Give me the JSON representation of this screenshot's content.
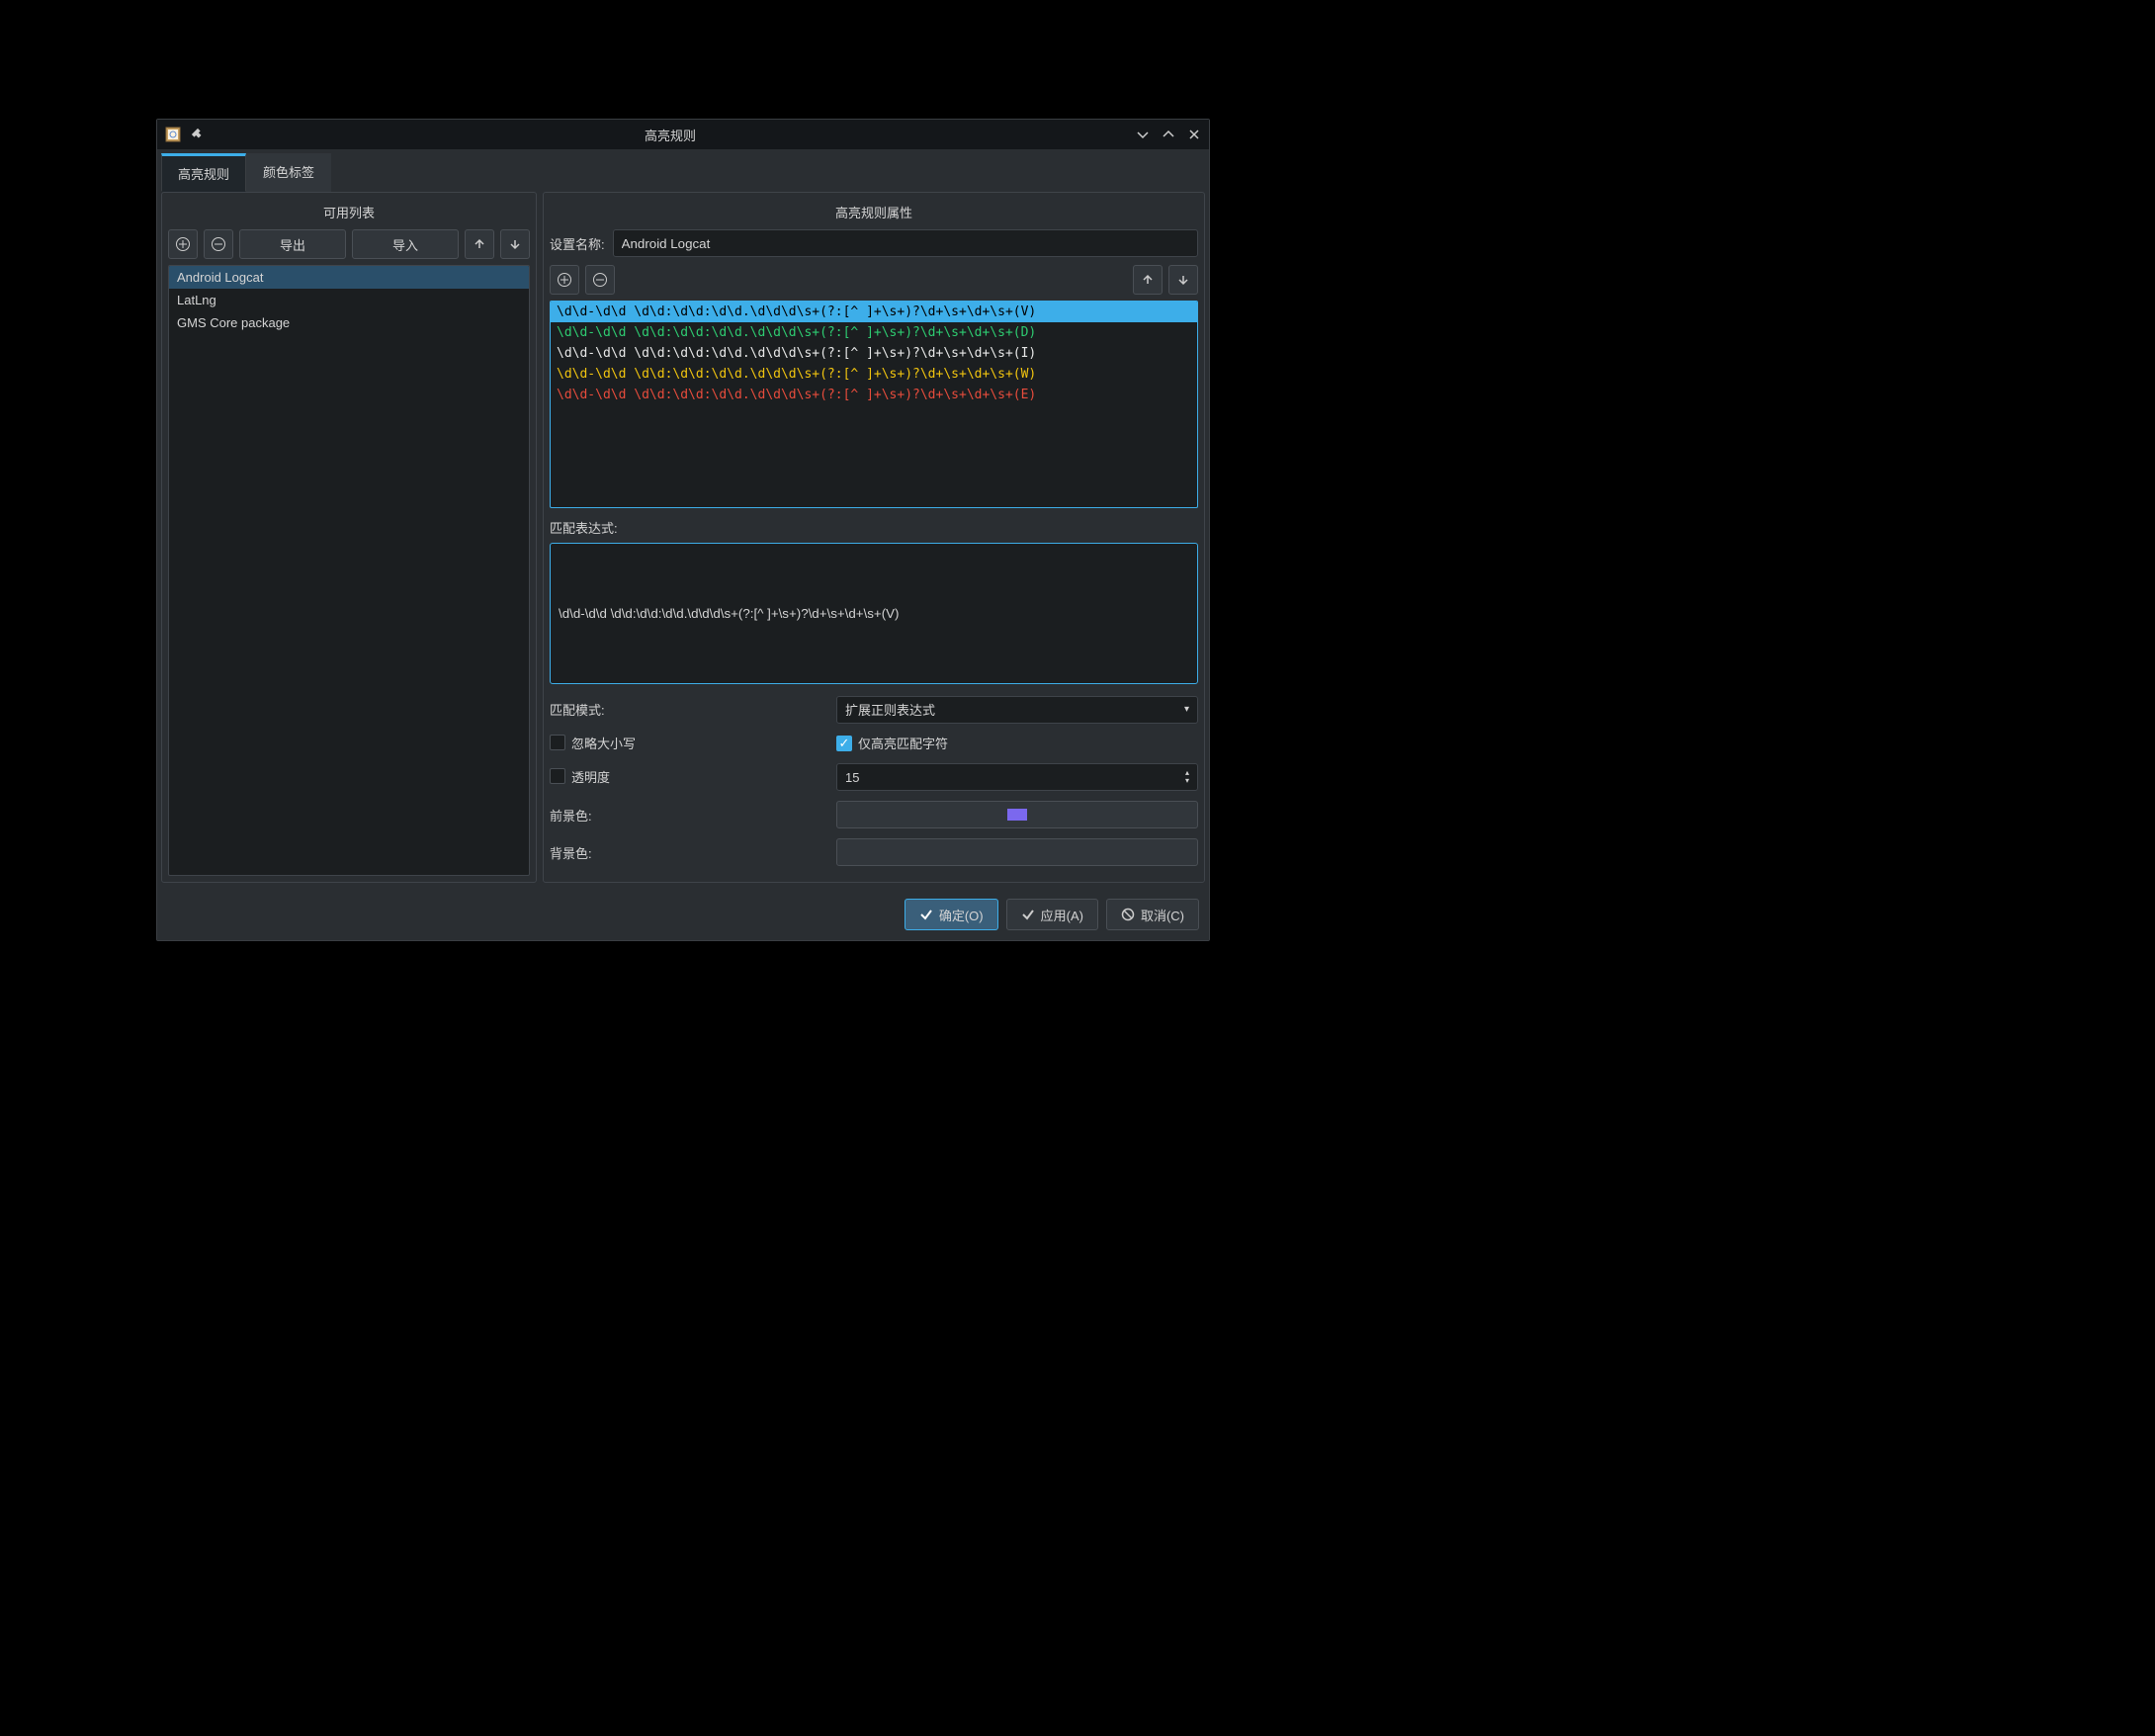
{
  "window": {
    "title": "高亮规则"
  },
  "tabs": {
    "highlight": "高亮规则",
    "color_tags": "颜色标签"
  },
  "left": {
    "header": "可用列表",
    "export_btn": "导出",
    "import_btn": "导入",
    "items": [
      "Android Logcat",
      "LatLng",
      "GMS Core package"
    ]
  },
  "right": {
    "header": "高亮规则属性",
    "name_label": "设置名称:",
    "name_value": "Android Logcat",
    "patterns": [
      {
        "text": "\\d\\d-\\d\\d \\d\\d:\\d\\d:\\d\\d.\\d\\d\\d\\s+(?:[^ ]+\\s+)?\\d+\\s+\\d+\\s+(V)",
        "color": "#000000",
        "selected": true
      },
      {
        "text": "\\d\\d-\\d\\d \\d\\d:\\d\\d:\\d\\d.\\d\\d\\d\\s+(?:[^ ]+\\s+)?\\d+\\s+\\d+\\s+(D)",
        "color": "#2ecc71",
        "selected": false
      },
      {
        "text": "\\d\\d-\\d\\d \\d\\d:\\d\\d:\\d\\d.\\d\\d\\d\\s+(?:[^ ]+\\s+)?\\d+\\s+\\d+\\s+(I)",
        "color": "#e8e8e8",
        "selected": false
      },
      {
        "text": "\\d\\d-\\d\\d \\d\\d:\\d\\d:\\d\\d.\\d\\d\\d\\s+(?:[^ ]+\\s+)?\\d+\\s+\\d+\\s+(W)",
        "color": "#f1c40f",
        "selected": false
      },
      {
        "text": "\\d\\d-\\d\\d \\d\\d:\\d\\d:\\d\\d.\\d\\d\\d\\s+(?:[^ ]+\\s+)?\\d+\\s+\\d+\\s+(E)",
        "color": "#e74c3c",
        "selected": false
      }
    ],
    "match_expr_label": "匹配表达式:",
    "match_expr_value": "\\d\\d-\\d\\d \\d\\d:\\d\\d:\\d\\d.\\d\\d\\d\\s+(?:[^ ]+\\s+)?\\d+\\s+\\d+\\s+(V)",
    "match_mode_label": "匹配模式:",
    "match_mode_value": "扩展正则表达式",
    "ignore_case_label": "忽略大小写",
    "highlight_only_label": "仅高亮匹配字符",
    "opacity_label": "透明度",
    "opacity_value": "15",
    "fg_label": "前景色:",
    "bg_label": "背景色:",
    "fg_color": "#7b68ee"
  },
  "buttons": {
    "ok": "确定(O)",
    "apply": "应用(A)",
    "cancel": "取消(C)"
  }
}
